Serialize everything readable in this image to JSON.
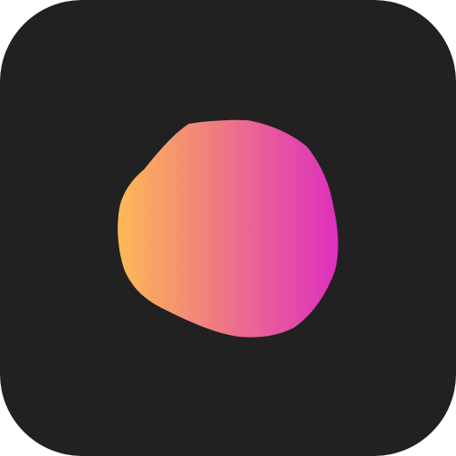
{
  "icon": {
    "name": "gradient-blob-app-icon",
    "background_color": "#212121",
    "gradient": {
      "start_color": "#FDBA55",
      "mid_color": "#F07A82",
      "end_color": "#DD2FBF"
    }
  }
}
